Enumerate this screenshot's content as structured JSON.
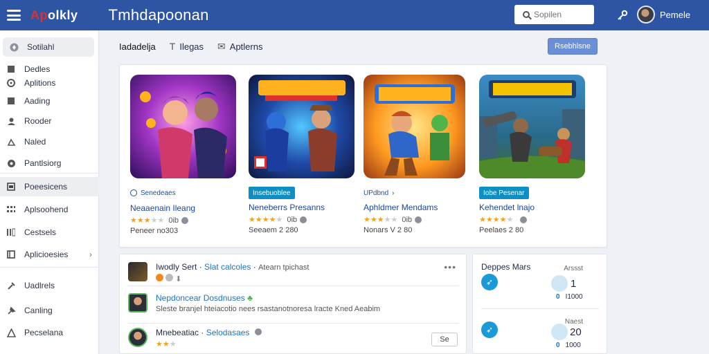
{
  "header": {
    "logo_red": "Ap",
    "logo_white": "olkly",
    "title": "Tmhdapoonan",
    "search_placeholder": "Sopilen",
    "user_name": "Pemele"
  },
  "sidebar": {
    "items": [
      {
        "label": "Sotilahl",
        "icon": "home-icon"
      },
      {
        "label": "Dedles",
        "icon": "library-icon"
      },
      {
        "label": "Aplitions",
        "icon": "apps-icon"
      },
      {
        "label": "Aading",
        "icon": "download-icon"
      },
      {
        "label": "Rooder",
        "icon": "user-icon"
      },
      {
        "label": "Naled",
        "icon": "store-icon"
      },
      {
        "label": "Pantlsiorg",
        "icon": "settings-icon"
      },
      {
        "label": "Poeesicens",
        "icon": "news-icon"
      },
      {
        "label": "Aplsoohend",
        "icon": "grid-icon"
      },
      {
        "label": "Cestsels",
        "icon": "list-icon"
      },
      {
        "label": "Aplicioesies",
        "icon": "book-icon"
      },
      {
        "label": "Uadlrels",
        "icon": "tools-icon"
      },
      {
        "label": "Canling",
        "icon": "pin-icon"
      },
      {
        "label": "Pecselana",
        "icon": "warning-icon"
      }
    ]
  },
  "tabs": [
    {
      "label": "Iadadelja",
      "icon": ""
    },
    {
      "label": "Ilegas",
      "icon": "text-icon"
    },
    {
      "label": "Aptlerns",
      "icon": "mail-icon"
    }
  ],
  "refresh_label": "Rsebhlsne",
  "games": [
    {
      "badge": "Senedeaes",
      "title": "Neaaenain Ileang",
      "stars": 3,
      "count": "0ib",
      "info": "Peneer no303"
    },
    {
      "badge": "Insebuoblee",
      "title": "Neneberrs Presanns",
      "stars": 4,
      "count": "0ib",
      "info": "Seeaem 2 280"
    },
    {
      "badge": "UPdbnd",
      "title": "Aphldmer Mendams",
      "stars": 3,
      "count": "0ib",
      "info": "Nonars V 2 80"
    },
    {
      "badge": "Iobe Pesenar",
      "title": "Kehendet lnajo",
      "stars": 4,
      "count": "",
      "info": "Peelaes 2 80"
    }
  ],
  "activity": {
    "rows": [
      {
        "user": "Iwodly Sert",
        "link": "Slat calcoles",
        "extra": "Atearn tpichast"
      },
      {
        "user": "Nepdoncear Dosdnuses",
        "link": "",
        "extra": "Sleste branjel hteiacotio nees rsastanotnoresa lracte Kned Aeabim"
      },
      {
        "user": "Mnebeatiac",
        "link": "Selodasaes",
        "extra": ""
      }
    ],
    "see_button": "Se"
  },
  "stats": {
    "title": "Deppes Mars",
    "col_label_1": "Arssst",
    "col_label_2": "Naest",
    "val_1": "1",
    "sub_1": "I1000",
    "val_2": "20",
    "sub_2": "1000"
  }
}
